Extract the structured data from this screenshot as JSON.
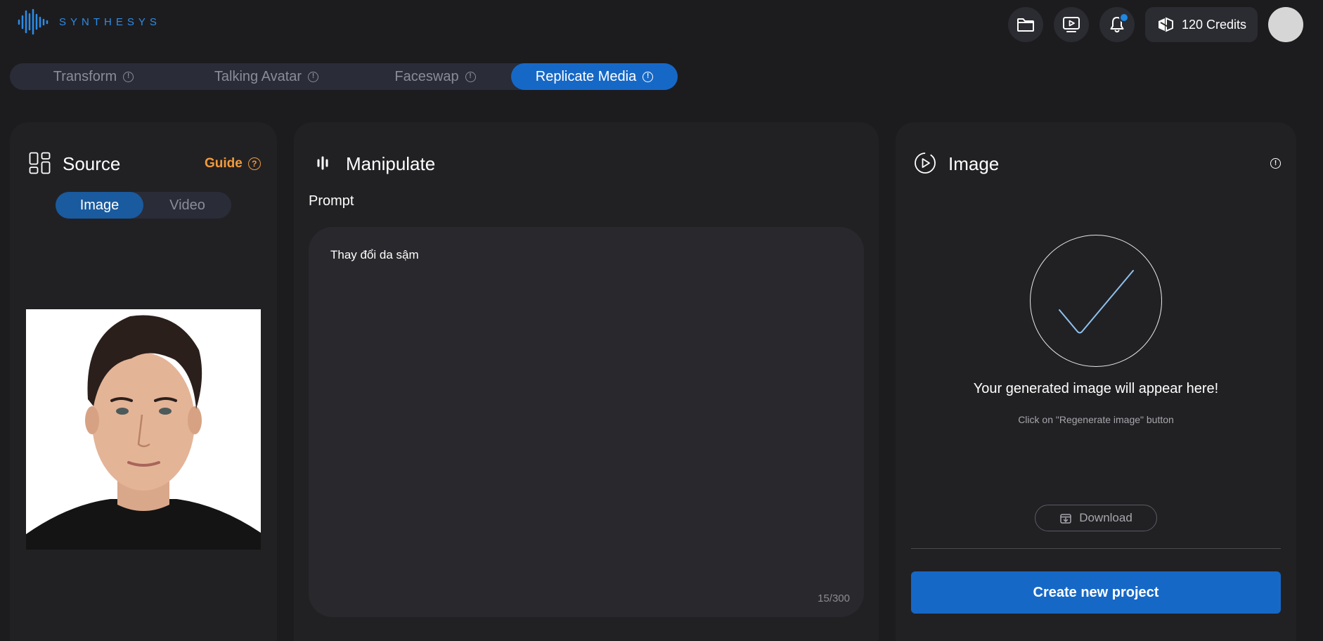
{
  "brand": {
    "name": "SYNTHESYS",
    "color": "#2e8ce6"
  },
  "header": {
    "icons": [
      "folder-icon",
      "video-library-icon",
      "bell-icon"
    ],
    "credits_label": "120 Credits",
    "credits_icon": "credits-logo-icon"
  },
  "modes": [
    {
      "label": "Transform",
      "active": false
    },
    {
      "label": "Talking Avatar",
      "active": false
    },
    {
      "label": "Faceswap",
      "active": false
    },
    {
      "label": "Replicate Media",
      "active": true
    }
  ],
  "source": {
    "title": "Source",
    "guide_label": "Guide",
    "segments": [
      {
        "label": "Image",
        "active": true
      },
      {
        "label": "Video",
        "active": false
      }
    ]
  },
  "manipulate": {
    "title": "Manipulate",
    "prompt_label": "Prompt",
    "prompt_value": "Thay đổi da sậm",
    "counter": "15/300"
  },
  "result": {
    "title": "Image",
    "placeholder_title": "Your generated image will appear here!",
    "placeholder_subtitle": "Click on \"Regenerate image\" button",
    "download_label": "Download",
    "create_label": "Create new project"
  },
  "colors": {
    "accent": "#1668c6",
    "guide": "#f39a3a",
    "background": "#1c1c1f",
    "panel": "#212124"
  }
}
